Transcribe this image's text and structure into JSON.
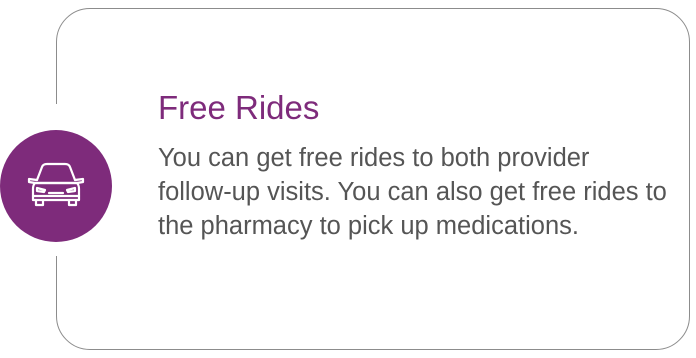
{
  "card": {
    "icon": "car-icon",
    "title": "Free Rides",
    "body": "You can get free rides to both provider follow-up visits. You can also get free rides to the pharmacy to pick up medications."
  },
  "colors": {
    "accent": "#7e2b7b",
    "icon_stroke": "#ffffff",
    "border": "#8c8c8c",
    "body_text": "#555555"
  }
}
